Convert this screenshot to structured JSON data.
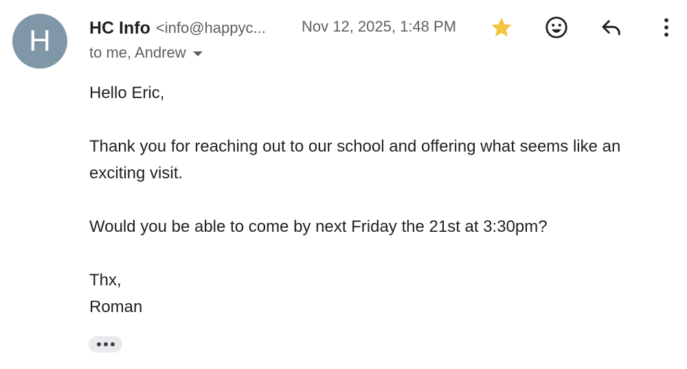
{
  "sender": {
    "avatar_letter": "H",
    "avatar_color": "#7f97a6",
    "name": "HC Info",
    "email": "<info@happyc..."
  },
  "date": "Nov 12, 2025, 1:48 PM",
  "recipients": "to me, Andrew",
  "actions": {
    "star_icon": "star-icon",
    "star_color": "#f4c542",
    "emoji_icon": "emoji-icon",
    "reply_icon": "reply-icon",
    "more_icon": "more-vert-icon"
  },
  "body": {
    "greeting": "Hello Eric,",
    "paragraph1": "Thank you for reaching out to our school and offering what seems like an exciting visit.",
    "paragraph2": "Would you be able to come by next Friday the 21st at 3:30pm?",
    "signoff": "Thx,",
    "signature": "Roman"
  }
}
